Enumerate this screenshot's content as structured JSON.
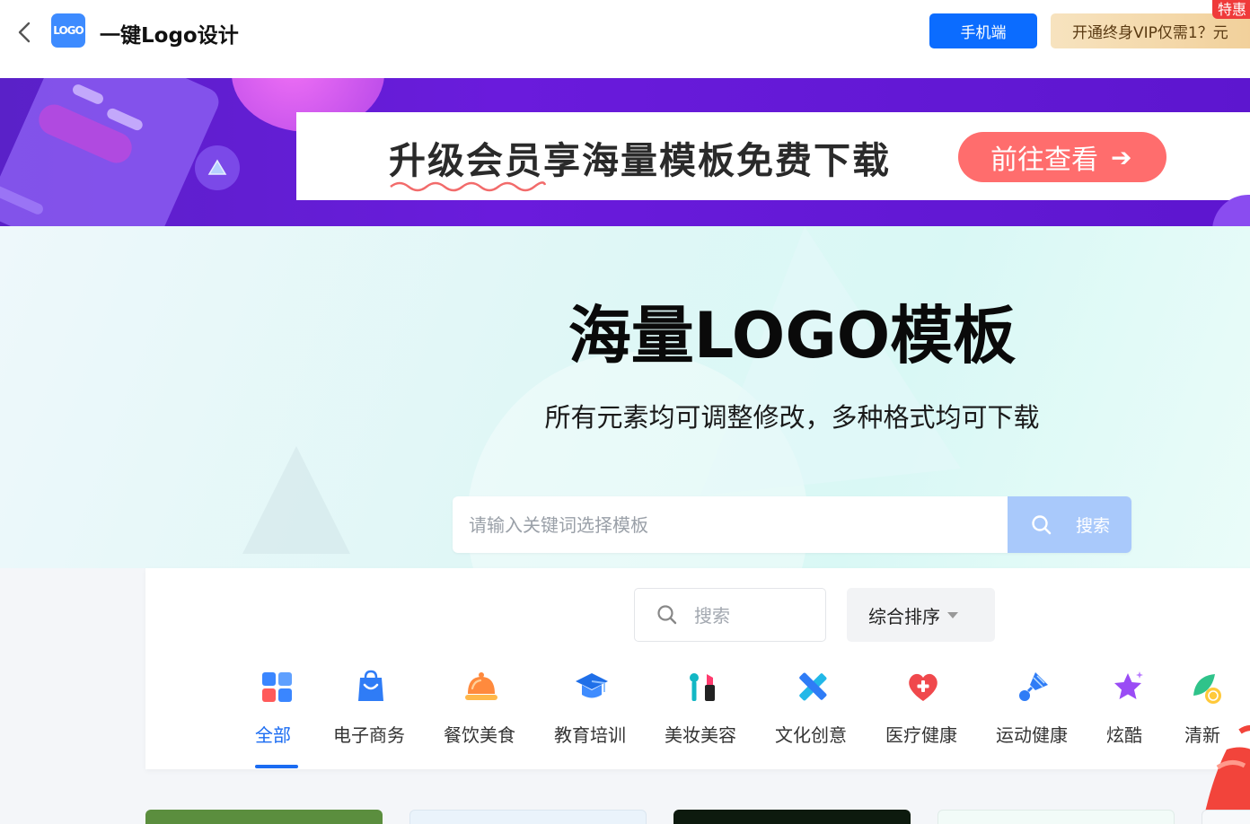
{
  "topbar": {
    "app_title": "一键Logo设计",
    "logo_text": "LOGO",
    "mobile_label": "手机端",
    "vip_label": "开通终身VIP仅需1？元",
    "special_badge": "特惠"
  },
  "banner": {
    "headline": "升级会员享海量模板免费下载",
    "cta_label": "前往查看"
  },
  "hero": {
    "title": "海量LOGO模板",
    "subtitle": "所有元素均可调整修改，多种格式均可下载",
    "search_placeholder": "请输入关键词选择模板",
    "search_button": "搜索"
  },
  "filters": {
    "search_placeholder": "搜索",
    "sort_label": "综合排序"
  },
  "categories": [
    {
      "label": "全部",
      "icon": "grid-icon",
      "active": true
    },
    {
      "label": "电子商务",
      "icon": "shopping-bag-icon",
      "active": false
    },
    {
      "label": "餐饮美食",
      "icon": "food-cloche-icon",
      "active": false
    },
    {
      "label": "教育培训",
      "icon": "graduation-cap-icon",
      "active": false
    },
    {
      "label": "美妆美容",
      "icon": "lipstick-icon",
      "active": false
    },
    {
      "label": "文化创意",
      "icon": "ruler-pencil-icon",
      "active": false
    },
    {
      "label": "医疗健康",
      "icon": "medical-heart-icon",
      "active": false
    },
    {
      "label": "运动健康",
      "icon": "badminton-icon",
      "active": false
    },
    {
      "label": "炫酷",
      "icon": "star-icon",
      "active": false
    },
    {
      "label": "清新",
      "icon": "leaf-coin-icon",
      "active": false
    }
  ],
  "colors": {
    "primary": "#0b6cff",
    "active_tab": "#1b6cf2",
    "banner_purple": "#6a1bdc",
    "cta_red": "#ff6d6d"
  }
}
